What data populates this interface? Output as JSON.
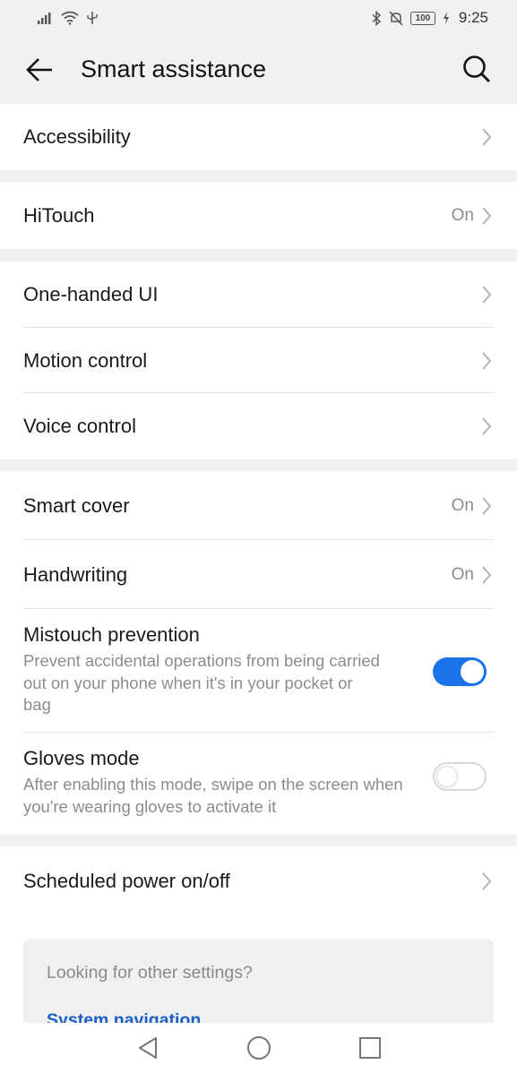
{
  "status_bar": {
    "battery": "100",
    "time": "9:25",
    "icons": [
      "signal-icon",
      "wifi-icon",
      "usb-icon",
      "bluetooth-icon",
      "mute-icon",
      "battery-icon",
      "charging-icon"
    ]
  },
  "app_bar": {
    "title": "Smart assistance",
    "back_icon": "arrow-left-icon",
    "search_icon": "search-icon"
  },
  "groups": {
    "accessibility": {
      "label": "Accessibility"
    },
    "hitouch": {
      "label": "HiTouch",
      "value": "On"
    },
    "one_handed": {
      "label": "One-handed UI"
    },
    "motion": {
      "label": "Motion control"
    },
    "voice": {
      "label": "Voice control"
    },
    "smart_cover": {
      "label": "Smart cover",
      "value": "On"
    },
    "handwriting": {
      "label": "Handwriting",
      "value": "On"
    },
    "mistouch": {
      "label": "Mistouch prevention",
      "desc": "Prevent accidental operations from being carried out on your phone when it's in your pocket or bag",
      "enabled": true
    },
    "gloves": {
      "label": "Gloves mode",
      "desc": "After enabling this mode, swipe on the screen when you're wearing gloves to activate it",
      "enabled": false
    },
    "scheduled": {
      "label": "Scheduled power on/off"
    }
  },
  "suggestion_card": {
    "title": "Looking for other settings?",
    "link": "System navigation"
  },
  "colors": {
    "accent": "#1a74e8",
    "background": "#f1f1f1",
    "secondary_text": "#8c8c8c",
    "link": "#1a5fc6"
  },
  "nav_bar": {
    "icons": [
      "back-triangle-icon",
      "home-circle-icon",
      "recents-square-icon"
    ]
  }
}
